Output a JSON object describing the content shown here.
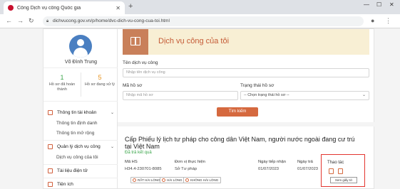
{
  "browser": {
    "tab_title": "Cổng Dịch vụ công Quốc gia",
    "url": "dichvucong.gov.vn/p/home/dvc-dich-vu-cong-cua-toi.html"
  },
  "sidebar": {
    "user_name": "Võ Đình Trung",
    "stats": [
      {
        "value": "1",
        "label": "Hồ sơ đã hoàn thành",
        "color": "#3aa54a"
      },
      {
        "value": "5",
        "label": "Hồ sơ đang xử lý",
        "color": "#e8931f"
      }
    ],
    "menu": {
      "account": {
        "label": "Thông tin tài khoản"
      },
      "account_items": [
        "Thông tin định danh",
        "Thông tin mở rộng"
      ],
      "services": {
        "label": "Quản lý dịch vụ công"
      },
      "services_items": [
        "Dịch vụ công của tôi"
      ],
      "documents": {
        "label": "Tài liệu điện tử"
      },
      "utilities": {
        "label": "Tiện ích"
      }
    }
  },
  "banner": {
    "title": "Dịch vụ công của tôi"
  },
  "form": {
    "service_label": "Tên dịch vụ công",
    "service_placeholder": "Nhập tên dịch vụ công",
    "code_label": "Mã hồ sơ",
    "code_placeholder": "Nhập mã hồ sơ",
    "status_label": "Trạng thái hồ sơ",
    "status_value": "-- Chọn trạng thái hồ sơ --",
    "search_label": "Tìm kiếm"
  },
  "result": {
    "title": "Cấp Phiếu lý lịch tư pháp cho công dân Việt Nam, người nước ngoài đang cư trú tại Việt Nam",
    "status": "Đã trả kết quả",
    "headers": {
      "code": "Mã HS",
      "agency": "Đơn vị thực hiện",
      "received": "Ngày tiếp nhận",
      "returned": "Ngày trả",
      "actions": "Thao tác"
    },
    "values": {
      "code": "H34.4-230701-8085",
      "agency": "Sở Tư pháp",
      "received": "01/07/2023",
      "returned": "01/07/2023"
    },
    "ratings": [
      "RẤT HÀI LÒNG",
      "HÀI LÒNG",
      "KHÔNG HÀI LÒNG"
    ],
    "tooltip": "Xem giấy tờ"
  },
  "colors": {
    "accent": "#d5693f",
    "banner_bg": "#f8efd4",
    "success": "#3aa54a",
    "highlight": "#e3352f"
  }
}
